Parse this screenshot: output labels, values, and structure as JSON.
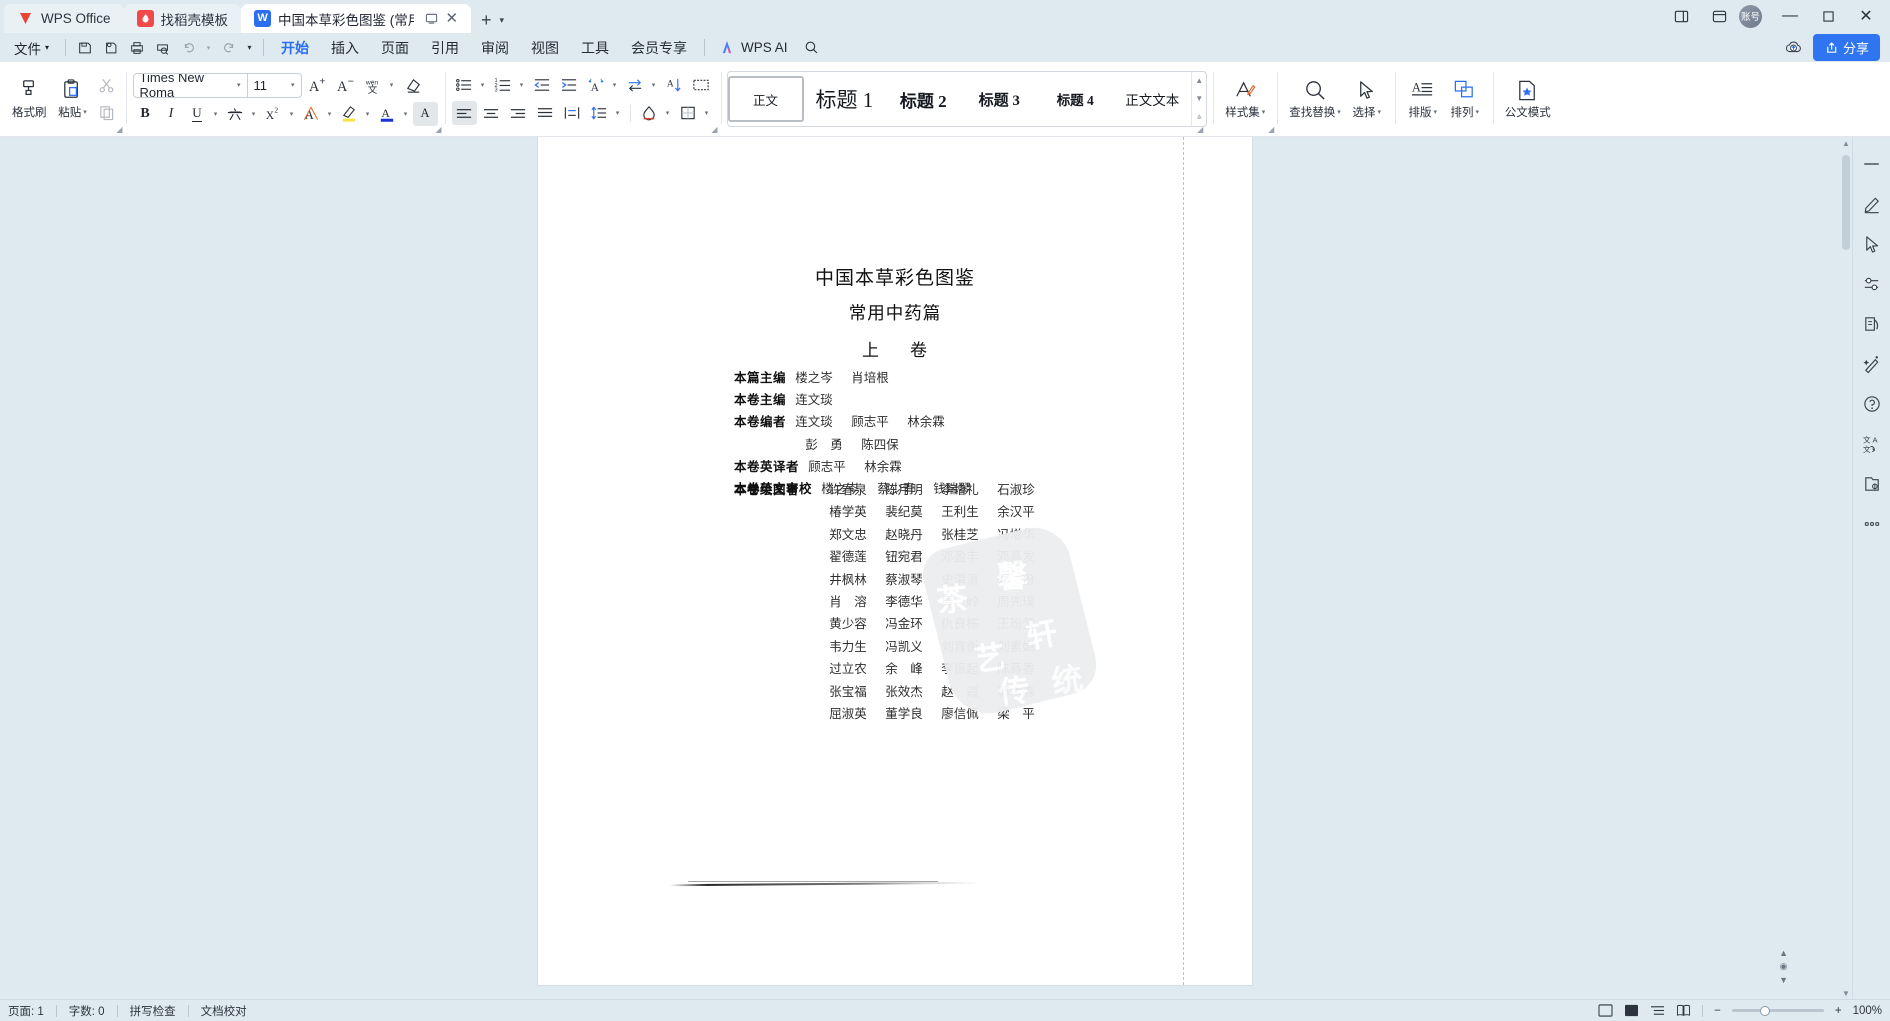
{
  "window": {
    "tabs": [
      {
        "label": "WPS Office",
        "icon": "wps-logo-icon",
        "type": "home"
      },
      {
        "label": "找稻壳模板",
        "icon": "docer-icon",
        "type": "docer"
      },
      {
        "label": "中国本草彩色图鉴 (常用中药篇",
        "icon": "word-doc-icon",
        "type": "doc",
        "active": true
      }
    ],
    "new_tab_label": "+",
    "account_initials": "账号",
    "controls": {
      "minimize": "—",
      "maximize": "▢",
      "close": "✕"
    }
  },
  "menubar": {
    "file_label": "文件",
    "quick_access": [
      "save-icon",
      "save-as-icon",
      "print-icon",
      "print-preview-icon",
      "undo-icon",
      "redo-icon",
      "customize-icon"
    ],
    "ribbon_tabs": [
      {
        "label": "开始",
        "active": true
      },
      {
        "label": "插入",
        "active": false
      },
      {
        "label": "页面",
        "active": false
      },
      {
        "label": "引用",
        "active": false
      },
      {
        "label": "审阅",
        "active": false
      },
      {
        "label": "视图",
        "active": false
      },
      {
        "label": "工具",
        "active": false
      },
      {
        "label": "会员专享",
        "active": false
      }
    ],
    "ai_label": "WPS AI",
    "search_icon": "search-icon",
    "cloud_icon": "cloud-upload-icon",
    "share_label": "分享"
  },
  "ribbon": {
    "clipboard": [
      {
        "label": "格式刷",
        "icon": "format-painter-icon",
        "dropdown": false
      },
      {
        "label": "粘贴",
        "icon": "paste-icon",
        "dropdown": true
      },
      {
        "label": "",
        "icon": "cut-icon",
        "disabled": true
      },
      {
        "label": "",
        "icon": "copy-icon",
        "disabled": true
      }
    ],
    "font": {
      "family_value": "Times New Roma",
      "size_value": "11",
      "buttons": [
        {
          "icon": "increase-font-size-icon",
          "name": "A+"
        },
        {
          "icon": "decrease-font-size-icon",
          "name": "A-"
        },
        {
          "icon": "phonetic-guide-icon",
          "name": "拼音指南"
        },
        {
          "icon": "clear-formatting-icon",
          "name": "清除格式"
        },
        {
          "icon": "bold-icon",
          "name": "B"
        },
        {
          "icon": "italic-icon",
          "name": "I"
        },
        {
          "icon": "underline-icon",
          "name": "U"
        },
        {
          "icon": "strikethrough-icon",
          "name": "删除线"
        },
        {
          "icon": "superscript-icon",
          "name": "X2"
        },
        {
          "icon": "character-border-icon",
          "name": "字符边框"
        },
        {
          "icon": "highlight-color-icon",
          "name": "突出显示"
        },
        {
          "icon": "font-color-icon",
          "name": "字体颜色"
        },
        {
          "icon": "character-shading-icon",
          "name": "字符底纹"
        }
      ]
    },
    "paragraph": [
      {
        "icon": "bullet-list-icon"
      },
      {
        "icon": "numbered-list-icon"
      },
      {
        "icon": "decrease-indent-icon"
      },
      {
        "icon": "increase-indent-icon"
      },
      {
        "icon": "asian-layout-icon"
      },
      {
        "icon": "ltr-rtl-icon"
      },
      {
        "icon": "sort-icon"
      },
      {
        "icon": "show-marks-icon"
      },
      {
        "icon": "align-left-icon",
        "active": true
      },
      {
        "icon": "align-center-icon"
      },
      {
        "icon": "align-right-icon"
      },
      {
        "icon": "align-justify-icon"
      },
      {
        "icon": "distribute-icon"
      },
      {
        "icon": "line-spacing-icon"
      },
      {
        "icon": "shading-icon"
      },
      {
        "icon": "borders-icon"
      }
    ],
    "styles": [
      {
        "label": "正文",
        "selected": true
      },
      {
        "label": "标题 1",
        "selected": false
      },
      {
        "label": "标题 2",
        "selected": false
      },
      {
        "label": "标题 3",
        "selected": false
      },
      {
        "label": "标题 4",
        "selected": false
      },
      {
        "label": "正文文本",
        "selected": false
      }
    ],
    "tools": [
      {
        "label": "样式集",
        "icon": "style-set-icon",
        "dropdown": true
      },
      {
        "label": "查找替换",
        "icon": "find-replace-icon",
        "dropdown": true
      },
      {
        "label": "选择",
        "icon": "select-cursor-icon",
        "dropdown": true
      },
      {
        "label": "排版",
        "icon": "typeset-icon",
        "dropdown": true
      },
      {
        "label": "排列",
        "icon": "arrange-icon",
        "dropdown": true
      },
      {
        "label": "公文模式",
        "icon": "official-doc-mode-icon",
        "dropdown": false
      }
    ]
  },
  "document": {
    "title_line1": "中国本草彩色图鉴",
    "title_line2": "常用中药篇",
    "title_line3_a": "上",
    "title_line3_b": "卷",
    "credits": [
      {
        "label": "本篇主编",
        "names": [
          "楼之岑",
          "肖培根"
        ]
      },
      {
        "label": "本卷主编",
        "names": [
          "连文琰"
        ]
      },
      {
        "label": "本卷编者",
        "names": [
          "连文琰",
          "顾志平",
          "林余霖"
        ]
      },
      {
        "label": "",
        "names": [
          "彭　勇",
          "陈四保"
        ]
      },
      {
        "label": "本卷英译者",
        "names": [
          "顾志平",
          "林余霖"
        ]
      },
      {
        "label": "本卷英文审校",
        "names": [
          "楼之岑",
          "蔡少青",
          "钱瑞琴"
        ]
      }
    ],
    "artists_label": "本卷绘图者",
    "artists_rows": [
      [
        "许春泉",
        "陈月明",
        "李增礼",
        "石淑珍"
      ],
      [
        "椿学英",
        "裴纪莫",
        "王利生",
        "余汉平"
      ],
      [
        "郑文忠",
        "赵晓丹",
        "张桂芝",
        "冯增华"
      ],
      [
        "翟德莲",
        "钮宛君",
        "邓盈丰",
        "邓晶发"
      ],
      [
        "井枫林",
        "蔡淑琴",
        "史渭清",
        "郑　份"
      ],
      [
        "肖　溶",
        "李德华",
        "周　岭",
        "周先璞"
      ],
      [
        "黄少容",
        "冯金环",
        "仇良栋",
        "王玢莹"
      ],
      [
        "韦力生",
        "冯凯义",
        "刘育衡",
        "刘素娟"
      ],
      [
        "过立农",
        "余　峰",
        "李振起",
        "陈蒔香"
      ],
      [
        "张宝福",
        "张效杰",
        "赵　霞",
        "郭木森"
      ],
      [
        "屈淑英",
        "董学良",
        "廖信佩",
        "梁　平"
      ]
    ],
    "seal_chars": [
      "茶",
      "艺",
      "馨",
      "轩",
      "传",
      "统"
    ]
  },
  "rail": {
    "items": [
      {
        "icon": "collapse-panel-icon",
        "name": "collapse"
      },
      {
        "icon": "pen-edit-icon",
        "name": "pen"
      },
      {
        "icon": "cursor-select-icon",
        "name": "select"
      },
      {
        "icon": "settings-sliders-icon",
        "name": "settings"
      },
      {
        "icon": "document-tools-icon",
        "name": "doc-tools"
      },
      {
        "icon": "magic-wand-icon",
        "name": "beautify"
      },
      {
        "icon": "help-circle-icon",
        "name": "help"
      },
      {
        "icon": "translate-icon",
        "name": "translate"
      },
      {
        "icon": "resource-library-icon",
        "name": "library"
      },
      {
        "icon": "more-dots-icon",
        "name": "more"
      }
    ]
  },
  "statusbar": {
    "left_items": [
      "页面: 1",
      "字数: 0",
      "拼写检查",
      "文档校对"
    ],
    "view_icons": [
      "page-view-icon",
      "web-view-icon",
      "outline-view-icon",
      "reading-view-icon"
    ],
    "zoom_level": "100%",
    "zoom_minus": "−",
    "zoom_plus": "+"
  }
}
